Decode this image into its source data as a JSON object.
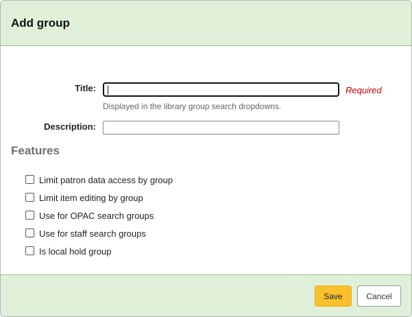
{
  "modal": {
    "title": "Add group"
  },
  "form": {
    "title_label": "Title:",
    "title_value": "",
    "required_text": "Required",
    "title_hint": "Displayed in the library group search dropdowns.",
    "description_label": "Description:",
    "description_value": ""
  },
  "features": {
    "heading": "Features",
    "items": [
      {
        "label": "Limit patron data access by group",
        "checked": false
      },
      {
        "label": "Limit item editing by group",
        "checked": false
      },
      {
        "label": "Use for OPAC search groups",
        "checked": false
      },
      {
        "label": "Use for staff search groups",
        "checked": false
      },
      {
        "label": "Is local hold group",
        "checked": false
      }
    ]
  },
  "footer": {
    "save_label": "Save",
    "cancel_label": "Cancel"
  },
  "colors": {
    "header_bg": "#e0f0d8",
    "save_button": "#fbc02d",
    "required": "#cc0000"
  }
}
